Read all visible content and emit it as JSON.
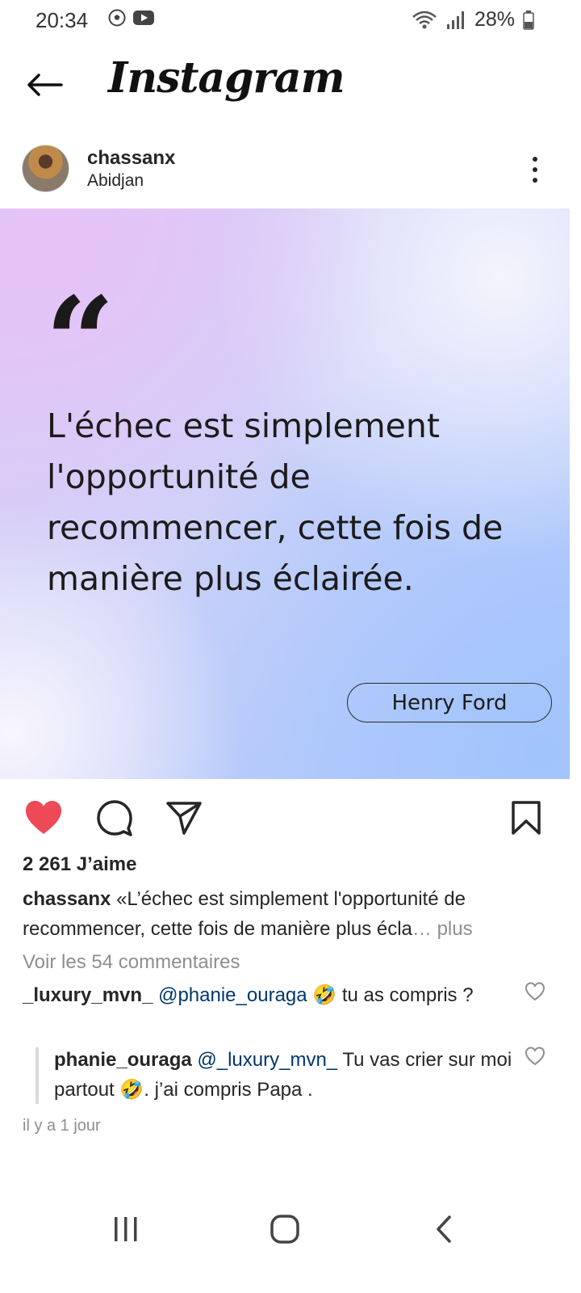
{
  "status_bar": {
    "time": "20:34",
    "battery": "28%"
  },
  "header": {
    "title": "Instagram"
  },
  "post": {
    "username": "chassanx",
    "location": "Abidjan",
    "image": {
      "quote_mark": "“",
      "quote": "L'échec est simplement l'opportunité de recommencer, cette fois de manière plus éclairée.",
      "author": "Henry Ford"
    },
    "likes": "2 261 J’aime",
    "caption_user": "chassanx",
    "caption_text": "«L’échec est simplement l'opportunité de recommencer, cette fois de manière plus écla",
    "caption_ellipsis": "…",
    "caption_more": "plus",
    "view_comments": "Voir les 54 commentaires",
    "comments": [
      {
        "user": "_luxury_mvn_",
        "mention": "@phanie_ouraga",
        "emoji": "🤣",
        "text": "tu as compris ?"
      },
      {
        "user": "phanie_ouraga",
        "mention": "@_luxury_mvn_",
        "text_a": "Tu vas crier sur moi partout",
        "emoji": "🤣",
        "text_b": ". j’ai compris Papa ."
      }
    ],
    "timestamp": "il y a 1 jour"
  },
  "colors": {
    "like_red": "#ed4956",
    "mention_blue": "#00376b",
    "muted_grey": "#8e8e8e"
  }
}
